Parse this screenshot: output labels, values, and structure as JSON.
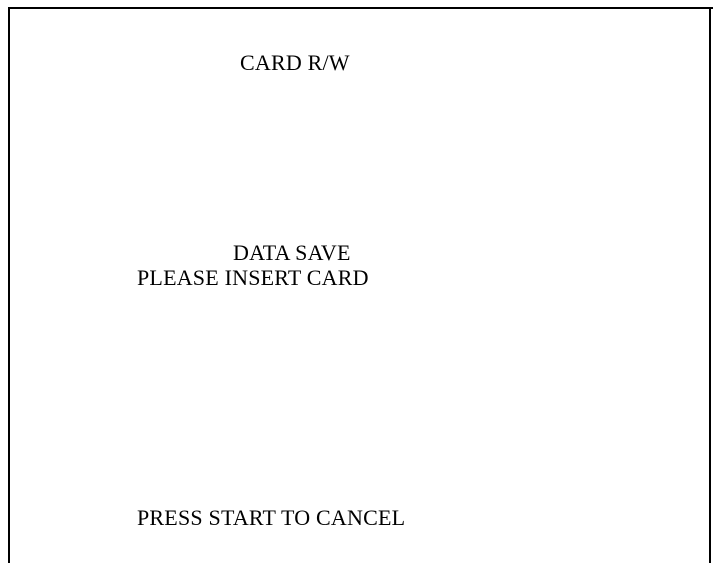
{
  "screen": {
    "title": "CARD R/W",
    "message_line_1": "DATA SAVE",
    "message_line_2": "PLEASE INSERT CARD",
    "footer_prompt": "PRESS START TO CANCEL"
  },
  "colors": {
    "background": "#ffffff",
    "text": "#000000",
    "frame": "#000000"
  }
}
